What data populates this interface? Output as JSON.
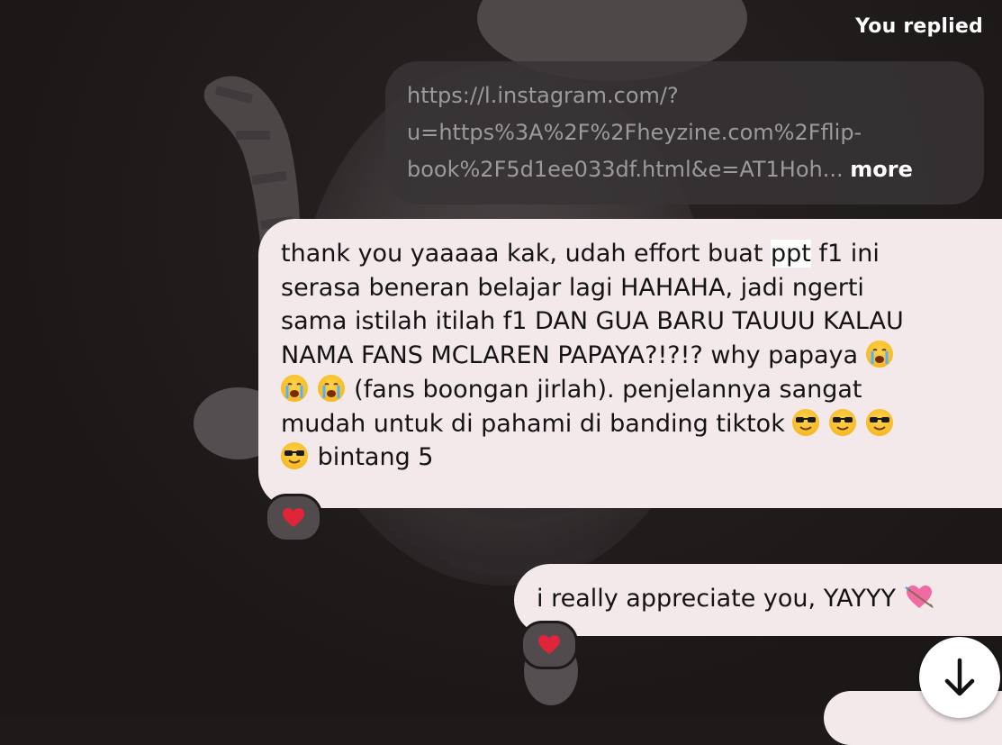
{
  "header": {
    "replied_label": "You replied"
  },
  "replied_message": {
    "lines": [
      "https://l.instagram.com/?",
      "u=https%3A%2F%2Fheyzine.com%2Fflip-",
      "book%2F5d1ee033df.html&e=AT1Hoh..."
    ],
    "more_label": "more"
  },
  "messages": [
    {
      "segments": {
        "l1_a": "thank you yaaaaa kak, udah effort buat ",
        "l1_hl": "ppt",
        "l1_b": " f1 ini",
        "l2": "serasa beneran belajar lagi HAHAHA, jadi ngerti",
        "l3": "sama istilah itilah f1 DAN GUA BARU TAUUU KALAU",
        "l4": "NAMA FANS MCLAREN PAPAYA?!?!? why papaya",
        "l5": " (fans boongan jirlah). penjelannya sangat",
        "l6": "mudah untuk di pahami di banding tiktok",
        "l7": " bintang 5"
      },
      "reaction": "red-heart-icon"
    },
    {
      "text": "i really appreciate you, YAYYY",
      "reaction": "red-heart-icon"
    }
  ],
  "icons": {
    "scroll_down": "arrow-down-icon",
    "sob": "loudly-crying-face-icon",
    "cool": "smiling-face-with-sunglasses-icon",
    "heart_arrow": "heart-with-arrow-icon"
  },
  "colors": {
    "background": "#1f1a1a",
    "link_bubble": "#383436",
    "link_text": "#9c9a9c",
    "message_bubble": "#f3e8ea",
    "reaction_pill": "#524b4d",
    "heart": "#e0243a"
  }
}
